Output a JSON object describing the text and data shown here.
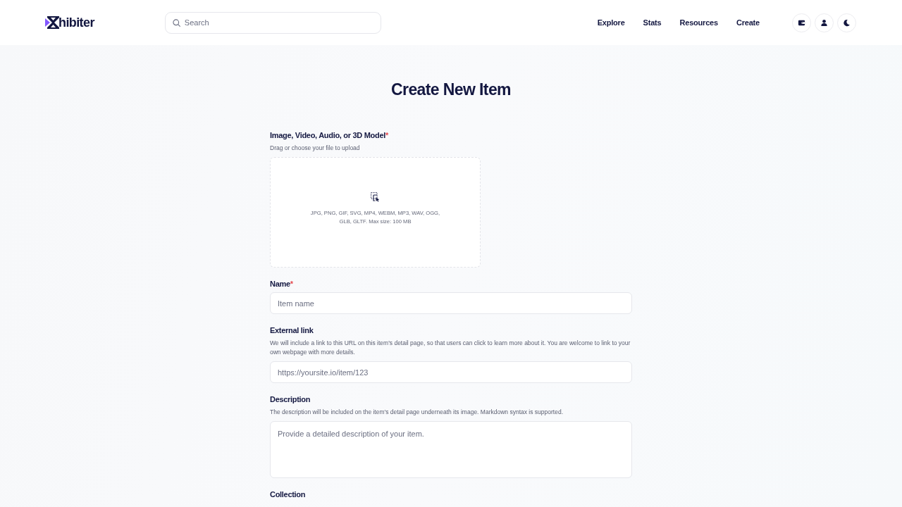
{
  "brand": {
    "name": "hibiter"
  },
  "search": {
    "placeholder": "Search"
  },
  "nav": [
    {
      "label": "Explore"
    },
    {
      "label": "Stats"
    },
    {
      "label": "Resources"
    },
    {
      "label": "Create"
    }
  ],
  "header_buttons": [
    {
      "kind": "wallet"
    },
    {
      "kind": "user"
    },
    {
      "kind": "theme"
    }
  ],
  "page": {
    "title": "Create New Item"
  },
  "form": {
    "fields": [
      {
        "kind": "upload",
        "label": "Image, Video, Audio, or 3D Model",
        "required_mark": "*",
        "help": "Drag or choose your file to upload",
        "formats": "JPG, PNG, GIF, SVG, MP4, WEBM, MP3, WAV, OGG, GLB, GLTF. Max size: 100 MB"
      },
      {
        "kind": "text",
        "label": "Name",
        "required_mark": "*",
        "placeholder": "Item name"
      },
      {
        "kind": "text",
        "label": "External link",
        "help": "We will include a link to this URL on this item's detail page, so that users can click to learn more about it. You are welcome to link to your own webpage with more details.",
        "placeholder": "https://yoursite.io/item/123"
      },
      {
        "kind": "textarea",
        "label": "Description",
        "help": "The description will be included on the item's detail page underneath its image. Markdown syntax is supported.",
        "placeholder": "Provide a detailed description of your item."
      },
      {
        "kind": "label_only",
        "label": "Collection"
      }
    ]
  }
}
